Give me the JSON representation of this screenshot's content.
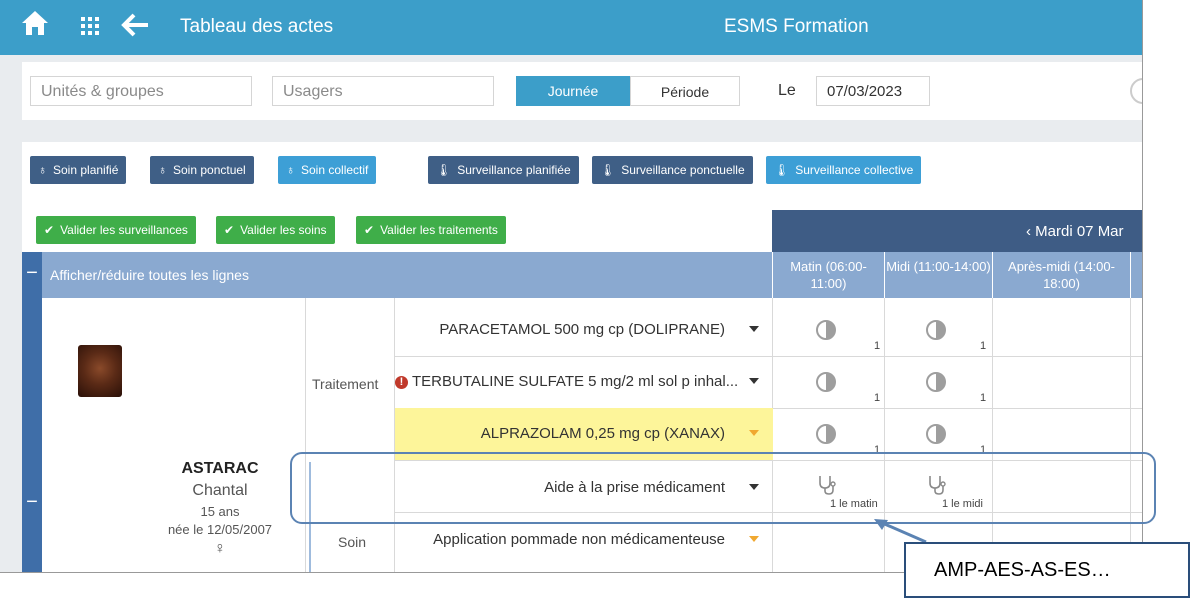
{
  "topbar": {
    "home_icon": "home-icon",
    "apps_icon": "grid-icon",
    "back_icon": "back-arrow-icon",
    "title": "Tableau des actes",
    "center_title": "ESMS Formation"
  },
  "filters": {
    "units_placeholder": "Unités & groupes",
    "users_placeholder": "Usagers",
    "mode_day": "Journée",
    "mode_period": "Période",
    "date_label": "Le",
    "date_value": "07/03/2023"
  },
  "buttons": {
    "soin_planifie": "Soin planifié",
    "soin_ponctuel": "Soin ponctuel",
    "soin_collectif": "Soin collectif",
    "surv_planifiee": "Surveillance planifiée",
    "surv_ponctuelle": "Surveillance ponctuelle",
    "surv_collective": "Surveillance collective",
    "valider_surveillances": "Valider les surveillances",
    "valider_soins": "Valider les soins",
    "valider_traitements": "Valider les traitements"
  },
  "day_nav": {
    "label": "‹  Mardi 07 Mar"
  },
  "table": {
    "expand_all": "Afficher/réduire toutes les lignes",
    "columns": [
      "Matin (06:00-11:00)",
      "Midi (11:00-14:00)",
      "Après-midi (14:00-18:00)"
    ],
    "patient": {
      "last_name": "ASTARAC",
      "first_name": "Chantal",
      "age": "15 ans",
      "birth": "née le 12/05/2007",
      "sex_symbol": "♀"
    },
    "categories": {
      "traitement": "Traitement",
      "soin": "Soin"
    },
    "rows": [
      {
        "label": "PARACETAMOL 500 mg cp (DOLIPRANE)",
        "matin": "1",
        "midi": "1"
      },
      {
        "label": "TERBUTALINE SULFATE 5 mg/2 ml sol p inhal...",
        "matin": "1",
        "midi": "1"
      },
      {
        "label": "ALPRAZOLAM 0,25 mg cp (XANAX)",
        "matin": "1",
        "midi": "1"
      },
      {
        "label": "Aide à la prise médicament",
        "matin": "1 le matin",
        "midi": "1 le midi"
      },
      {
        "label": "Application pommade non médicamenteuse"
      }
    ]
  },
  "callout": {
    "text": "AMP-AES-AS-ES…"
  },
  "colors": {
    "topbar": "#3c9ec9",
    "dark_button": "#3f5f86",
    "green_button": "#3fae49",
    "header": "#8aa9d0"
  }
}
